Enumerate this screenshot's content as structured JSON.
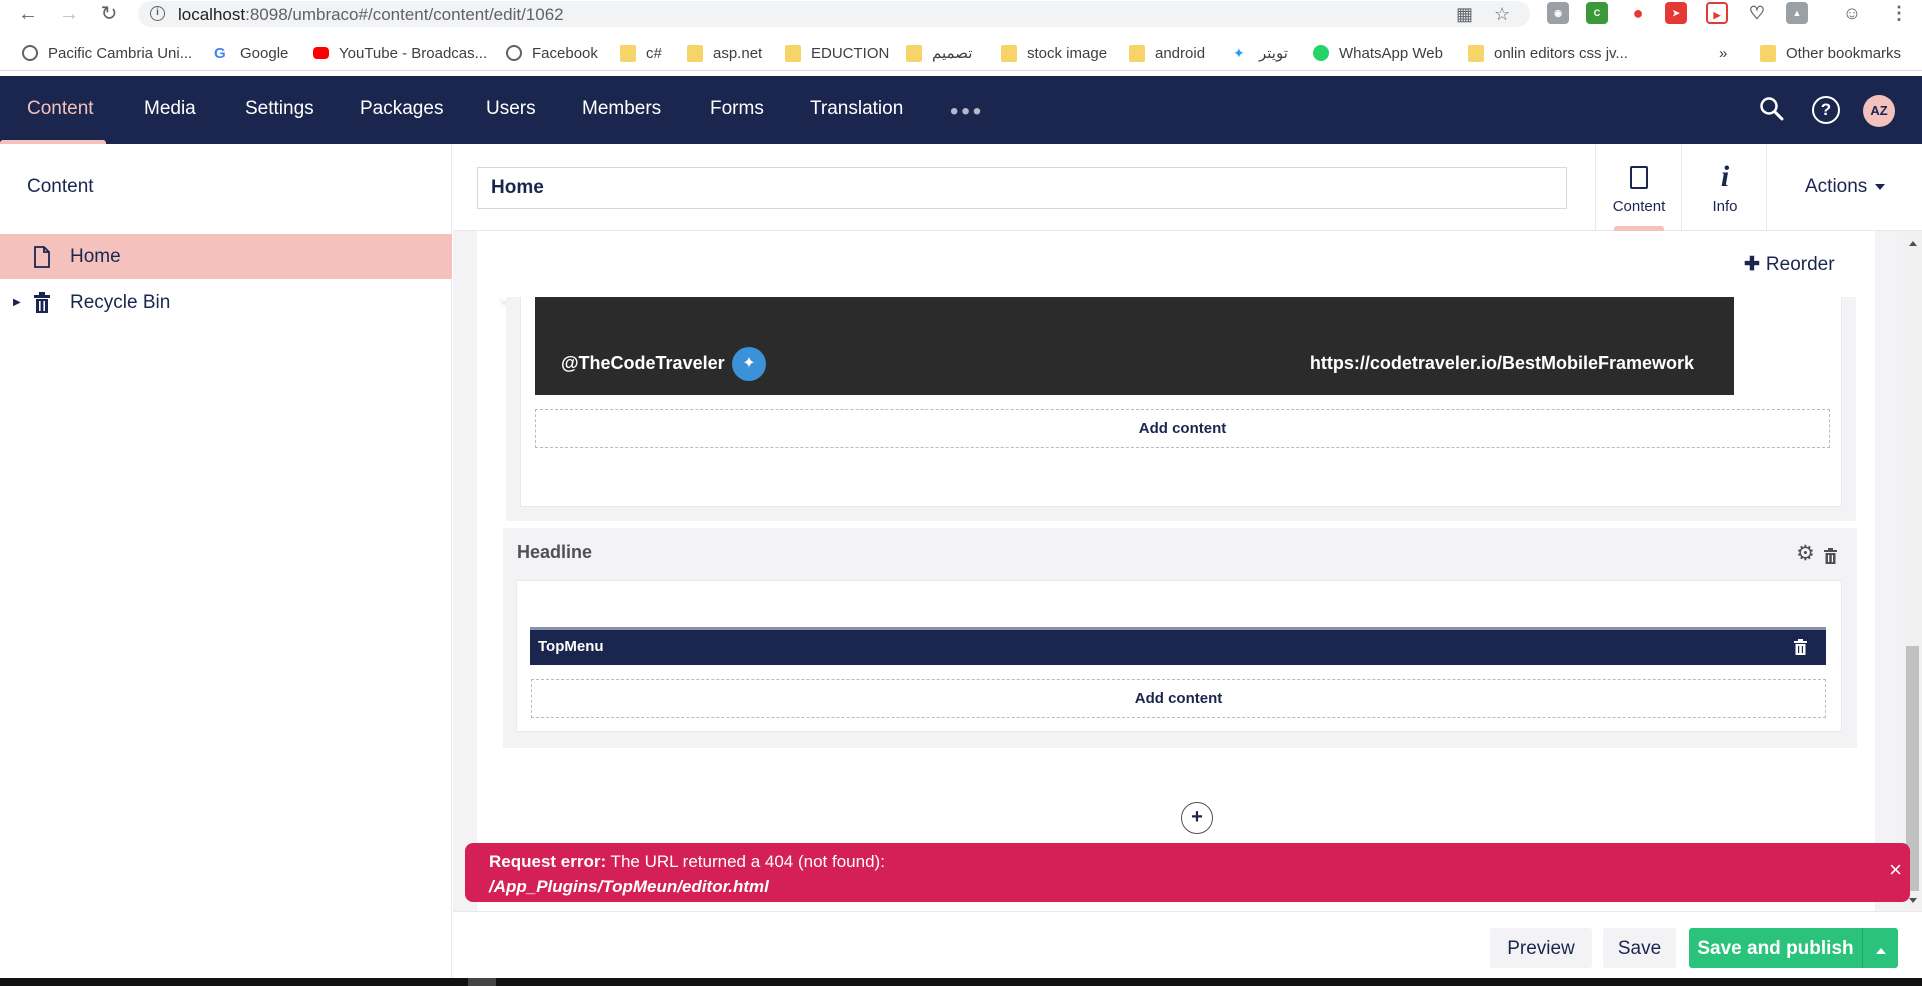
{
  "browser": {
    "url_host": "localhost",
    "url_rest": ":8098/umbraco#/content/content/edit/1062",
    "bookmarks": [
      {
        "label": "Pacific Cambria Uni...",
        "icon": "globe-icon"
      },
      {
        "label": "Google",
        "icon": "google-icon"
      },
      {
        "label": "YouTube - Broadcas...",
        "icon": "youtube-icon"
      },
      {
        "label": "Facebook",
        "icon": "globe-icon"
      },
      {
        "label": "c#",
        "icon": "folder-icon"
      },
      {
        "label": "asp.net",
        "icon": "folder-icon"
      },
      {
        "label": "EDUCTION",
        "icon": "folder-icon"
      },
      {
        "label": "تصميم",
        "icon": "folder-icon"
      },
      {
        "label": "stock image",
        "icon": "folder-icon"
      },
      {
        "label": "android",
        "icon": "folder-icon"
      },
      {
        "label": "تويتر",
        "icon": "twitter-icon"
      },
      {
        "label": "WhatsApp Web",
        "icon": "whatsapp-icon"
      },
      {
        "label": "onlin editors css jv...",
        "icon": "folder-icon"
      }
    ],
    "overflow": "»",
    "other_bookmarks": "Other bookmarks"
  },
  "topnav": {
    "items": [
      "Content",
      "Media",
      "Settings",
      "Packages",
      "Users",
      "Members",
      "Forms",
      "Translation"
    ],
    "more": "•••",
    "avatar_initials": "AZ"
  },
  "sidebar": {
    "title": "Content",
    "items": [
      {
        "label": "Home",
        "icon": "document-icon",
        "selected": true
      },
      {
        "label": "Recycle Bin",
        "icon": "trash-icon",
        "selected": false
      }
    ]
  },
  "editor": {
    "name_value": "Home",
    "tabs": [
      {
        "label": "Content",
        "icon": "document-icon",
        "active": true
      },
      {
        "label": "Info",
        "icon": "info-icon",
        "active": false
      }
    ],
    "actions_label": "Actions"
  },
  "grid": {
    "reorder_label": "Reorder",
    "banner": {
      "handle": "@TheCodeTraveler",
      "url": "https://codetraveler.io/BestMobileFramework"
    },
    "add_content_label": "Add content",
    "headline": {
      "title": "Headline",
      "block_label": "TopMenu"
    }
  },
  "notification": {
    "prefix": "Request error:",
    "message": " The URL returned a 404 (not found):",
    "path": "/App_Plugins/TopMeun/editor.html"
  },
  "footer": {
    "preview_label": "Preview",
    "save_label": "Save",
    "publish_label": "Save and publish"
  },
  "colors": {
    "brand_navy": "#1b264f",
    "accent_pink": "#f5c1bc",
    "error_red": "#d42054",
    "publish_green": "#2bc37c"
  }
}
